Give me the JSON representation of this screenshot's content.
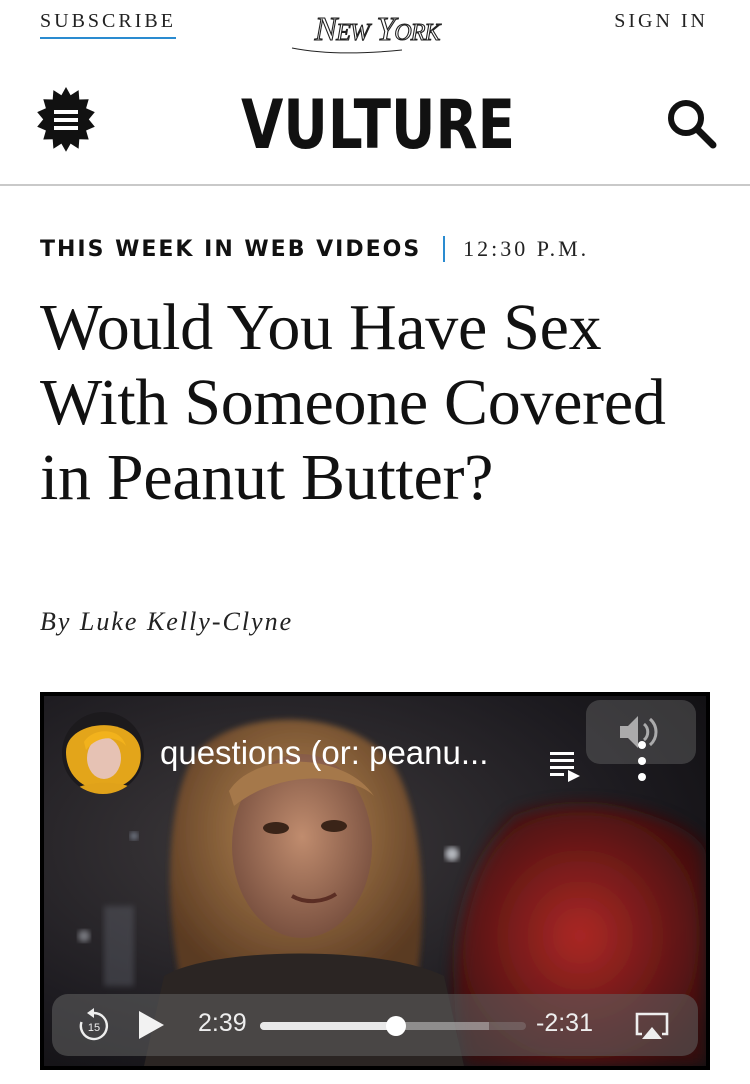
{
  "topbar": {
    "subscribe_label": "SUBSCRIBE",
    "brand": "New York",
    "signin_label": "SIGN IN"
  },
  "header": {
    "logo_text": "VULTURE",
    "menu_icon": "menu-icon",
    "search_icon": "search-icon"
  },
  "article": {
    "rubric": "THIS WEEK IN WEB VIDEOS",
    "timestamp": "12:30 P.M.",
    "headline": "Would You Have Sex With Someone Covered in Peanut Butter?",
    "byline": "By Luke Kelly-Clyne"
  },
  "video": {
    "title": "questions (or: peanu...",
    "elapsed": "2:39",
    "remaining": "-2:31",
    "progress": 0.51,
    "buffered": 0.86,
    "skip_back_seconds": "15"
  },
  "colors": {
    "accent_blue": "#2a8bd0",
    "text": "#111111",
    "divider": "#c9c9c9"
  }
}
